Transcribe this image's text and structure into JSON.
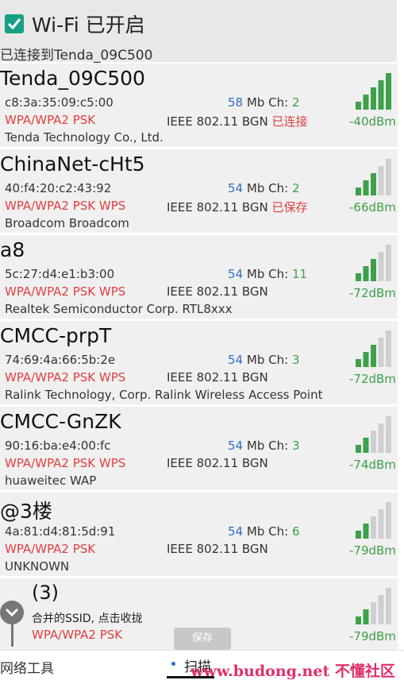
{
  "header": {
    "wifi_label": "Wi-Fi 已开启",
    "connected_text": "已连接到Tenda_09C500"
  },
  "networks": [
    {
      "ssid": "Tenda_09C500",
      "mac": "c8:3a:35:09:c5:00",
      "speed": "58",
      "speed_unit": "Mb",
      "ch_label": "Ch:",
      "channel": "2",
      "security": "WPA/WPA2 PSK",
      "standard": "IEEE 802.11 BGN",
      "state": "已连接",
      "vendor": "Tenda Technology Co., Ltd.",
      "signal": "-40dBm",
      "strength_bars": 5
    },
    {
      "ssid": "ChinaNet-cHt5",
      "mac": "40:f4:20:c2:43:92",
      "speed": "54",
      "speed_unit": "Mb",
      "ch_label": "Ch:",
      "channel": "2",
      "security": "WPA/WPA2 PSK WPS",
      "standard": "IEEE 802.11 BGN",
      "state": "已保存",
      "vendor": "Broadcom Broadcom",
      "signal": "-66dBm",
      "strength_bars": 3
    },
    {
      "ssid": "a8",
      "mac": "5c:27:d4:e1:b3:00",
      "speed": "54",
      "speed_unit": "Mb",
      "ch_label": "Ch:",
      "channel": "11",
      "security": "WPA/WPA2 PSK WPS",
      "standard": "IEEE 802.11 BGN",
      "state": "",
      "vendor": "Realtek Semiconductor Corp. RTL8xxx",
      "signal": "-72dBm",
      "strength_bars": 3
    },
    {
      "ssid": "CMCC-prpT",
      "mac": "74:69:4a:66:5b:2e",
      "speed": "54",
      "speed_unit": "Mb",
      "ch_label": "Ch:",
      "channel": "3",
      "security": "WPA/WPA2 PSK WPS",
      "standard": "IEEE 802.11 BGN",
      "state": "",
      "vendor": "Ralink Technology, Corp. Ralink Wireless Access Point",
      "signal": "-72dBm",
      "strength_bars": 3
    },
    {
      "ssid": "CMCC-GnZK",
      "mac": "90:16:ba:e4:00:fc",
      "speed": "54",
      "speed_unit": "Mb",
      "ch_label": "Ch:",
      "channel": "3",
      "security": "WPA/WPA2 PSK WPS",
      "standard": "IEEE 802.11 BGN",
      "state": "",
      "vendor": "huaweitec WAP",
      "signal": "-74dBm",
      "strength_bars": 2
    },
    {
      "ssid": "@3楼",
      "mac": "4a:81:d4:81:5d:91",
      "speed": "54",
      "speed_unit": "Mb",
      "ch_label": "Ch:",
      "channel": "6",
      "security": "WPA/WPA2 PSK",
      "standard": "IEEE 802.11 BGN",
      "state": "",
      "vendor": "UNKNOWN",
      "signal": "-79dBm",
      "strength_bars": 2
    }
  ],
  "merged": {
    "count": "(3)",
    "hint": "合并的SSID, 点击收拢",
    "security": "WPA/WPA2 PSK",
    "signal": "-79dBm",
    "strength_bars": 2
  },
  "toast": "保存",
  "tabs": {
    "tools": "网络工具",
    "scan": "扫描"
  },
  "watermark": "www.budong.net 不懂社区",
  "colors": {
    "accent": "#17a085",
    "signal_green": "#3ea04a",
    "signal_gray": "#cfcfcf",
    "security_red": "#e04040",
    "speed_blue": "#2c6fc7"
  }
}
